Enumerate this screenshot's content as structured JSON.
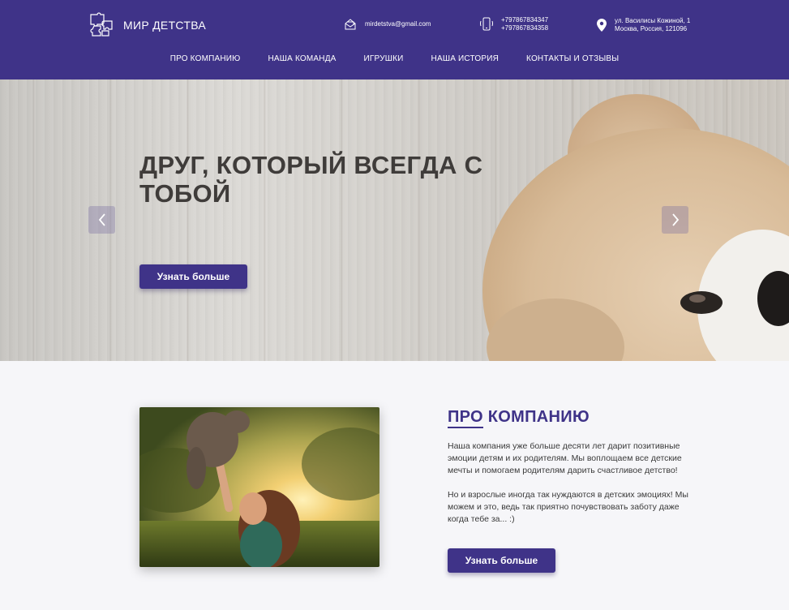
{
  "brand": {
    "name": "МИР ДЕТСТВА",
    "logo_icon": "puzzle-logo-icon"
  },
  "contacts": {
    "email": "mirdetstva@gmail.com",
    "phones": [
      "+797867834347",
      "+797867834358"
    ],
    "address": [
      "ул. Василисы Кожиной, 1",
      "Москва, Россия, 121096"
    ]
  },
  "nav": {
    "items": [
      "ПРО КОМПАНИЮ",
      "НАША КОМАНДА",
      "ИГРУШКИ",
      "НАША ИСТОРИЯ",
      "КОНТАКТЫ И ОТЗЫВЫ"
    ]
  },
  "hero": {
    "title": "ДРУГ, КОТОРЫЙ ВСЕГДА С ТОБОЙ",
    "button": "Узнать больше"
  },
  "about": {
    "title_first": "ПРО",
    "title_rest": " КОМПАНИЮ",
    "paragraphs": [
      "Наша компания уже больше десяти лет дарит позитивные эмоции детям и их родителям. Мы воплощаем все детские мечты и помогаем родителям дарить счастливое детство!",
      "Но и взрослые иногда так нуждаются в детских эмоциях! Мы можем и это, ведь так приятно почувствовать заботу даже когда тебе за... :)"
    ],
    "button": "Узнать больше"
  },
  "colors": {
    "primary": "#3f3388",
    "background": "#f6f6f9",
    "hero_text": "#3f3c3a"
  }
}
